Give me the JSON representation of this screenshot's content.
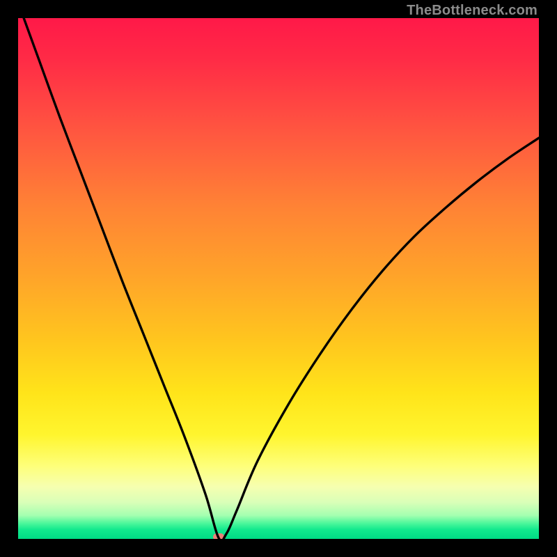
{
  "watermark": "TheBottleneck.com",
  "colors": {
    "frame": "#000000",
    "curve": "#000000",
    "marker": "#e98378",
    "watermark": "#8b8b8b"
  },
  "chart_data": {
    "type": "line",
    "title": "",
    "xlabel": "",
    "ylabel": "",
    "xlim": [
      0,
      100
    ],
    "ylim": [
      0,
      100
    ],
    "grid": false,
    "legend": false,
    "series": [
      {
        "name": "bottleneck-curve",
        "x": [
          0,
          4,
          8,
          12,
          16,
          20,
          24,
          28,
          32,
          36,
          38.5,
          40,
          42,
          46,
          52,
          58,
          64,
          70,
          76,
          82,
          88,
          94,
          100
        ],
        "y": [
          103,
          92,
          81,
          70.5,
          60,
          49.5,
          39.5,
          29.5,
          19.5,
          8.5,
          0.2,
          1.0,
          5.5,
          15,
          26,
          35.5,
          44,
          51.5,
          58,
          63.5,
          68.5,
          73,
          77
        ]
      }
    ],
    "marker": {
      "x": 38.5,
      "y": 0.4,
      "w": 2.2,
      "h": 1.4
    },
    "gradient_stops": [
      {
        "pos": 0,
        "color": "#ff1948"
      },
      {
        "pos": 0.36,
        "color": "#ff8235"
      },
      {
        "pos": 0.72,
        "color": "#ffe41a"
      },
      {
        "pos": 0.9,
        "color": "#f6ffb0"
      },
      {
        "pos": 1.0,
        "color": "#00db85"
      }
    ]
  }
}
